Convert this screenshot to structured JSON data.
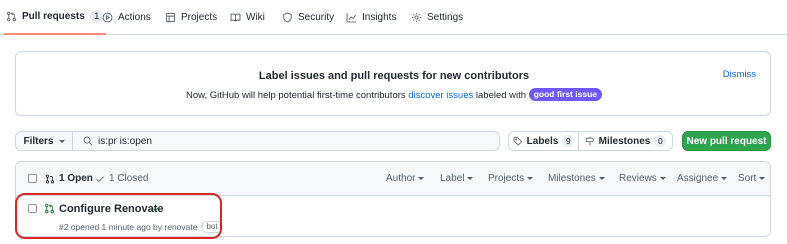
{
  "nav": {
    "tabs": [
      {
        "label": "Pull requests",
        "count": "1",
        "icon": "git-pull-request-icon",
        "selected": true
      },
      {
        "label": "Actions",
        "icon": "play-icon"
      },
      {
        "label": "Projects",
        "icon": "table-icon"
      },
      {
        "label": "Wiki",
        "icon": "book-icon"
      },
      {
        "label": "Security",
        "icon": "shield-icon"
      },
      {
        "label": "Insights",
        "icon": "graph-icon"
      },
      {
        "label": "Settings",
        "icon": "gear-icon"
      }
    ],
    "selected_underline_color": "#fd8c73"
  },
  "banner": {
    "title": "Label issues and pull requests for new contributors",
    "text_before": "Now, GitHub will help potential first-time contributors",
    "link": "discover issues",
    "text_after": "labeled with",
    "label": "good first issue",
    "label_color": "#7057ff",
    "dismiss": "Dismiss"
  },
  "filter": {
    "button": "Filters",
    "query": "is:pr is:open"
  },
  "labels_button": {
    "label": "Labels",
    "count": "9"
  },
  "milestones_button": {
    "label": "Milestones",
    "count": "0"
  },
  "new_pr_button": {
    "label": "New pull request",
    "color": "#2da44e"
  },
  "list": {
    "open_label": "1 Open",
    "closed_label": "1 Closed",
    "sort_filters": [
      "Author",
      "Label",
      "Projects",
      "Milestones",
      "Reviews",
      "Assignee",
      "Sort"
    ],
    "items": [
      {
        "title": "Configure Renovate",
        "meta": "#2 opened 1 minute ago by renovate",
        "badge": "bot",
        "status": "success"
      }
    ]
  },
  "annotation_color": "#e02424"
}
